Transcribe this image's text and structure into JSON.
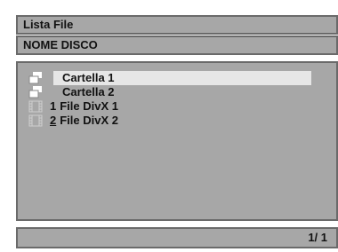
{
  "header": {
    "title": "Lista File"
  },
  "disc": {
    "name": "NOME DISCO"
  },
  "list": {
    "items": [
      {
        "type": "folder",
        "icon": "folder-icon",
        "num": "",
        "label": "Cartella 1",
        "selected": true
      },
      {
        "type": "folder",
        "icon": "folder-icon",
        "num": "",
        "label": "Cartella 2",
        "selected": false
      },
      {
        "type": "file",
        "icon": "film-icon",
        "num": "1",
        "label": "File DivX 1",
        "selected": false
      },
      {
        "type": "file",
        "icon": "film-icon",
        "num": "2",
        "label": "File DivX 2",
        "selected": false
      }
    ]
  },
  "footer": {
    "page": "1/ 1"
  },
  "colors": {
    "panel": "#a7a7a7",
    "border": "#6a6a6a",
    "highlight": "#e6e6e6",
    "text": "#111111",
    "icon": "#ffffff"
  }
}
